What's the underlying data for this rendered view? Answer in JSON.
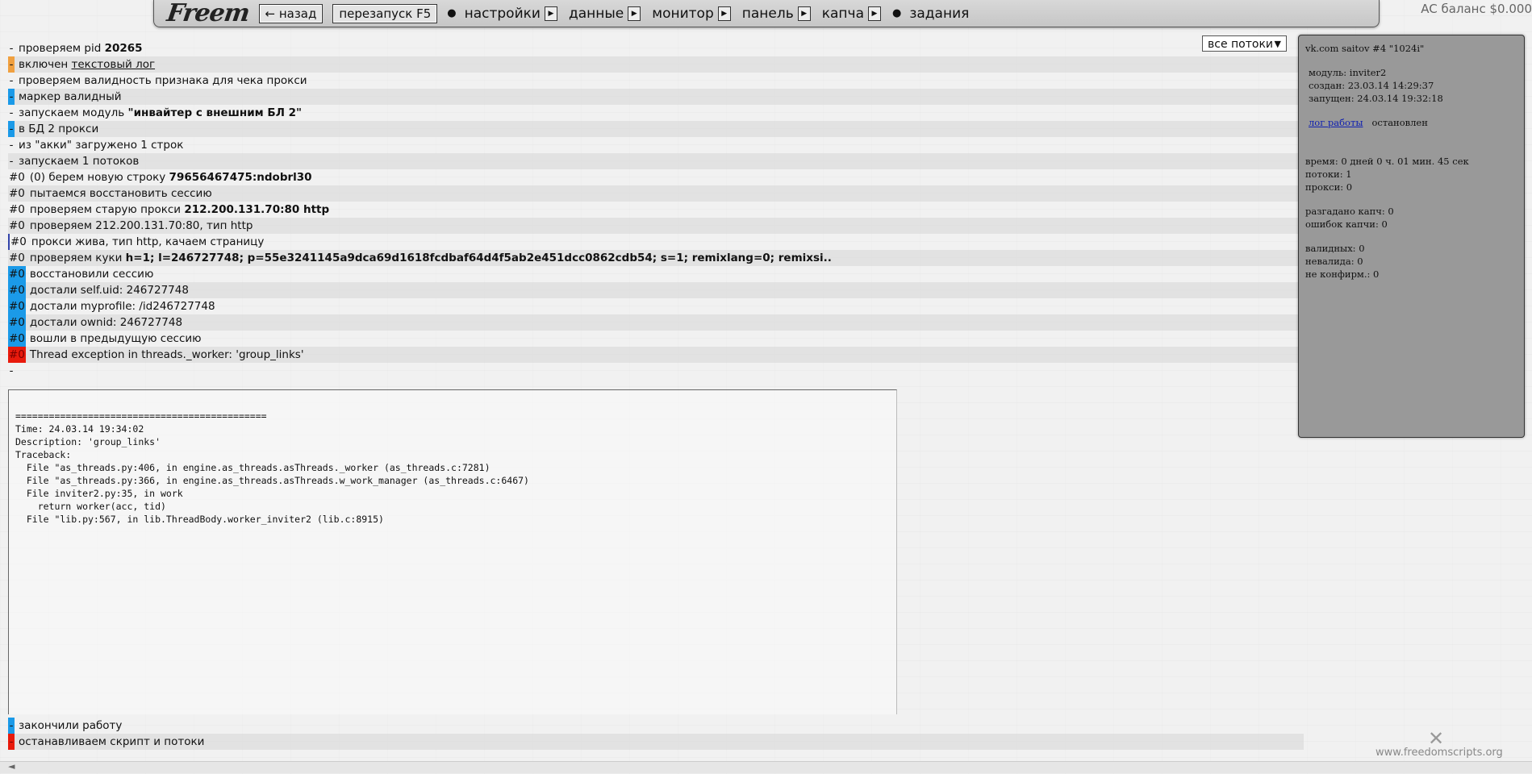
{
  "nav": {
    "logo": "Freem",
    "back": "← назад",
    "restart": "перезапуск F5",
    "items": [
      "настройки",
      "данные",
      "монитор",
      "панель",
      "капча"
    ],
    "tasks": "задания",
    "balance": "AC баланс $0.000"
  },
  "select": {
    "value": "все потоки"
  },
  "log": [
    {
      "mk": "-",
      "t": "проверяем pid ",
      "b": "20265"
    },
    {
      "mk": "-",
      "mkc": "orange",
      "t": "включен ",
      "link": "текстовый лог"
    },
    {
      "mk": "-",
      "t": "проверяем валидность признака для чека прокси"
    },
    {
      "mk": "-",
      "mkc": "blue",
      "t": "маркер валидный"
    },
    {
      "mk": "-",
      "t": "запускаем модуль ",
      "b": "\"инвайтер с внешним БЛ 2\""
    },
    {
      "mk": "-",
      "mkc": "blue",
      "t": "в БД 2 прокси"
    },
    {
      "mk": "-",
      "t": "из \"акки\" загружено 1 строк"
    },
    {
      "mk": "-",
      "t": "запускаем 1 потоков"
    },
    {
      "mk": "#0",
      "t": "(0) берем новую строку ",
      "b": "79656467475:ndobrl30"
    },
    {
      "mk": "#0",
      "t": "пытаемся восстановить сессию"
    },
    {
      "mk": "#0",
      "t": "проверяем старую прокси ",
      "b": "212.200.131.70:80 http"
    },
    {
      "mk": "#0",
      "t": "проверяем 212.200.131.70:80, тип http"
    },
    {
      "mk": "#0",
      "mkc": "bar",
      "t": "прокси жива, тип http, качаем страницу"
    },
    {
      "mk": "#0",
      "t": "проверяем куки ",
      "b": "h=1; l=246727748; p=55e3241145a9dca69d1618fcdbaf64d4f5ab2e451dcc0862cdb54; s=1; remixlang=0; remixsi.."
    },
    {
      "mk": "#0",
      "mkc": "blue",
      "t": "восстановили сессию"
    },
    {
      "mk": "#0",
      "mkc": "blue",
      "t": "достали self.uid: 246727748"
    },
    {
      "mk": "#0",
      "mkc": "blue",
      "t": "достали myprofile: /id246727748"
    },
    {
      "mk": "#0",
      "mkc": "blue",
      "t": "достали ownid: 246727748"
    },
    {
      "mk": "#0",
      "mkc": "blue",
      "t": "вошли в предыдущую сессию"
    },
    {
      "mk": "#0",
      "mkc": "red",
      "t": "Thread exception in threads._worker: 'group_links'"
    },
    {
      "mk": "-",
      "t": ""
    }
  ],
  "traceback": [
    "=============================================",
    "Time: 24.03.14 19:34:02",
    "Description: 'group_links'",
    "Traceback:",
    "  File \"as_threads.py:406, in engine.as_threads.asThreads._worker (as_threads.c:7281)",
    "  File \"as_threads.py:366, in engine.as_threads.asThreads.w_work_manager (as_threads.c:6467)",
    "  File inviter2.py:35, in work",
    "    return worker(acc, tid)",
    "  File \"lib.py:567, in lib.ThreadBody.worker_inviter2 (lib.c:8915)"
  ],
  "log_end": [
    {
      "mk": "-",
      "mkc": "blue",
      "t": "закончили работу"
    },
    {
      "mk": "-",
      "mkc": "red",
      "t": "останавливаем скрипт и потоки"
    }
  ],
  "panel": {
    "title": "vk.com saitov #4 \"1024i\"",
    "module": "модуль: inviter2",
    "created": "создан: 23.03.14 14:29:37",
    "started": "запущен: 24.03.14 19:32:18",
    "log_link": "лог работы",
    "status": "остановлен",
    "time": "время: 0 дней 0 ч. 01 мин. 45 сек",
    "threads": "потоки: 1",
    "proxies": "прокси: 0",
    "captcha_solved": "разгадано капч: 0",
    "captcha_errors": "ошибок капчи: 0",
    "valid": "валидных: 0",
    "invalid": "невалида: 0",
    "not_confirmed": "не конфирм.: 0"
  },
  "footer": {
    "site": "www.freedomscripts.org",
    "arrow": "◄"
  }
}
